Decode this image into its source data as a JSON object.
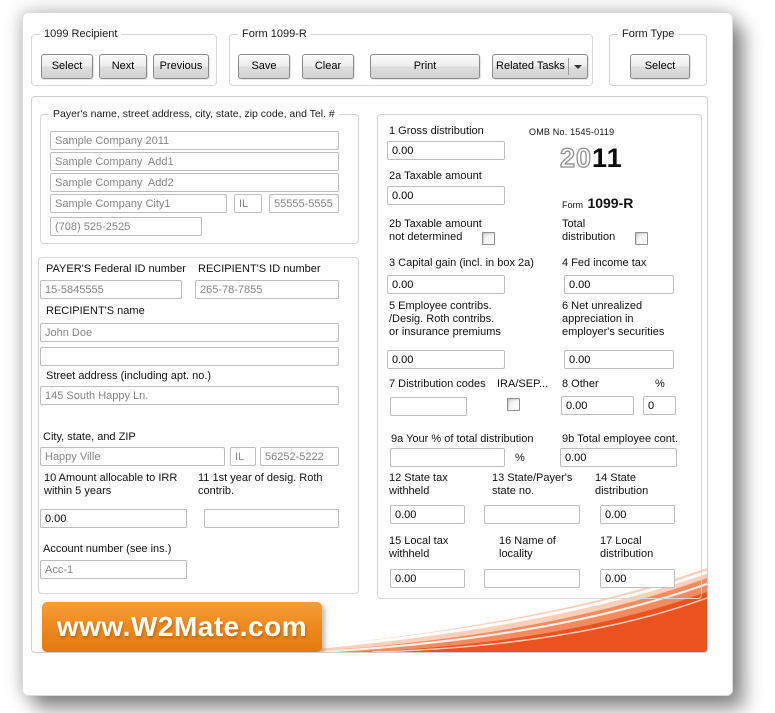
{
  "toolbar": {
    "recipient_group": {
      "title": "1099 Recipient",
      "select": "Select",
      "next": "Next",
      "previous": "Previous"
    },
    "form_group": {
      "title": "Form 1099-R",
      "save": "Save",
      "clear": "Clear",
      "print": "Print",
      "related_tasks": "Related Tasks"
    },
    "form_type_group": {
      "title": "Form Type",
      "select": "Select"
    }
  },
  "payer_box": {
    "title": "Payer's name, street address, city, state, zip code, and Tel. #",
    "name": "Sample Company 2011",
    "address1": "Sample Company  Add1",
    "address2": "Sample Company  Add2",
    "city": "Sample Company City1",
    "state": "IL",
    "zip": "55555-5555",
    "phone": "(708) 525-2525"
  },
  "recipient_box": {
    "payer_id_label": "PAYER'S Federal ID number",
    "payer_id": "15-5845555",
    "recipient_id_label": "RECIPIENT'S ID number",
    "recipient_id": "265-78-7855",
    "name_label": "RECIPIENT'S name",
    "name": "John Doe",
    "name2": "",
    "street_label": "Street address (including apt. no.)",
    "street": "145 South Happy Ln.",
    "city_label": "City, state, and ZIP",
    "city": "Happy Ville",
    "state": "IL",
    "zip": "56252-5222",
    "box10_label": "10 Amount allocable to IRR\nwithin 5 years",
    "box10": "0.00",
    "box11_label": "11 1st year of desig. Roth\ncontrib.",
    "box11": "",
    "account_label": "Account number (see ins.)",
    "account": "Acc-1"
  },
  "form1099r": {
    "omb": "OMB No. 1545-0119",
    "year_outline": "20",
    "year_bold": "11",
    "form_word": "Form",
    "form_number": "1099-R",
    "box1_label": "1 Gross distribution",
    "box1": "0.00",
    "box2a_label": "2a Taxable amount",
    "box2a": "0.00",
    "box2b_label": "2b Taxable amount\nnot determined",
    "box2b_checked": false,
    "total_dist_label": "Total\ndistribution",
    "total_dist_checked": false,
    "box3_label": "3 Capital gain (incl. in box 2a)",
    "box3": "0.00",
    "box4_label": "4 Fed income tax",
    "box4": "0.00",
    "box5_label": "5 Employee contribs.\n/Desig. Roth contribs.\nor insurance premiums",
    "box5": "0.00",
    "box6_label": "6 Net unrealized\nappreciation in\nemployer's securities",
    "box6": "0.00",
    "box7_label": "7 Distribution codes",
    "box7": "",
    "ira_sep_label": "IRA/SEP...",
    "ira_sep_checked": false,
    "box8_label": "8 Other",
    "box8": "0.00",
    "box8_pct_label": "%",
    "box8_pct": "0",
    "box9a_label": "9a Your % of total distribution",
    "box9a": "",
    "box9a_pct_label": "%",
    "box9b_label": "9b Total employee cont.",
    "box9b": "0.00",
    "box12_label": "12 State tax\nwithheld",
    "box12": "0.00",
    "box13_label": "13 State/Payer's\nstate no.",
    "box13": "",
    "box14_label": "14 State\ndistribution",
    "box14": "0.00",
    "box15_label": "15 Local tax\nwithheld",
    "box15": "0.00",
    "box16_label": "16 Name of\nlocality",
    "box16": "",
    "box17_label": "17 Local\ndistribution",
    "box17": "0.00"
  },
  "banner": {
    "text": "www.W2Mate.com"
  },
  "colors": {
    "banner_orange": "#EE8A1F",
    "swoosh_deep": "#EC5120",
    "swoosh_mid": "#F28C60",
    "swoosh_pale": "#FAD0BD"
  }
}
